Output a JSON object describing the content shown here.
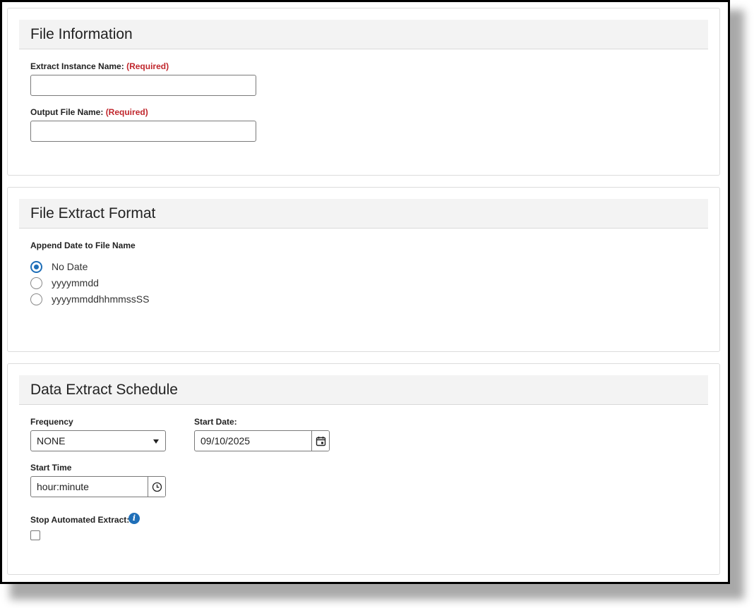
{
  "file_information": {
    "title": "File Information",
    "extract_instance_label": "Extract Instance Name:",
    "output_file_label": "Output File Name:",
    "required_tag": "(Required)",
    "extract_instance_value": "",
    "output_file_value": ""
  },
  "file_extract_format": {
    "title": "File Extract Format",
    "append_label": "Append Date to File Name",
    "options": [
      {
        "label": "No Date",
        "checked": true
      },
      {
        "label": "yyyymmdd",
        "checked": false
      },
      {
        "label": "yyyymmddhhmmssSS",
        "checked": false
      }
    ]
  },
  "schedule": {
    "title": "Data Extract Schedule",
    "frequency_label": "Frequency",
    "frequency_value": "NONE",
    "start_date_label": "Start Date:",
    "start_date_value": "09/10/2025",
    "start_time_label": "Start Time",
    "start_time_placeholder": "hour:minute",
    "stop_label": "Stop Automated Extract:",
    "stop_checked": false,
    "info_glyph": "i"
  },
  "icons": {
    "calendar": "calendar-icon",
    "clock": "clock-icon",
    "info": "info-icon",
    "caret": "chevron-down-icon"
  },
  "colors": {
    "accent": "#1f6fb8",
    "required": "#c0262c",
    "header_bg": "#f3f3f3"
  }
}
